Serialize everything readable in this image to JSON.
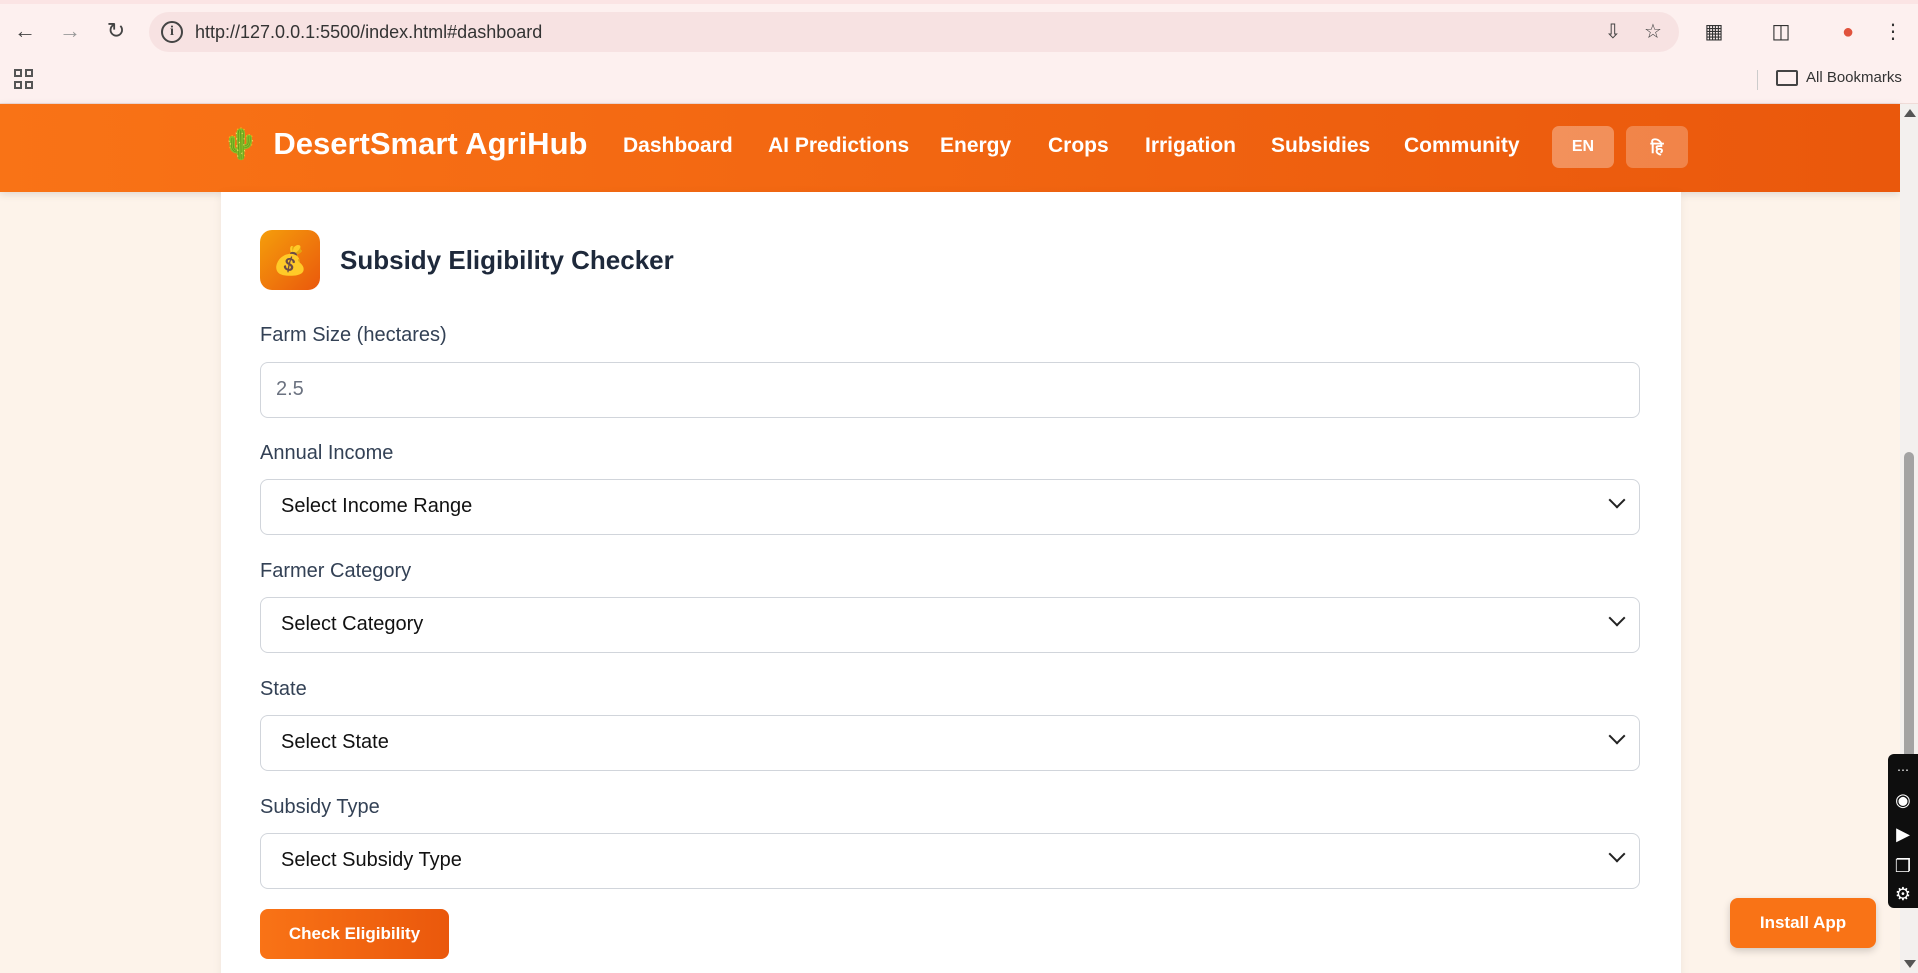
{
  "browser": {
    "url": "http://127.0.0.1:5500/index.html#dashboard",
    "bookmarks_label": "All Bookmarks"
  },
  "app": {
    "brand_icon": "🌵",
    "brand_name": "DesertSmart AgriHub",
    "nav": [
      "Dashboard",
      "AI Predictions",
      "Energy",
      "Crops",
      "Irrigation",
      "Subsidies",
      "Community"
    ],
    "lang": {
      "en": "EN",
      "hi": "हि"
    }
  },
  "card": {
    "icon": "💰",
    "title": "Subsidy Eligibility Checker",
    "fields": [
      {
        "label": "Farm Size (hectares)",
        "type": "input",
        "placeholder": "2.5"
      },
      {
        "label": "Annual Income",
        "type": "select",
        "value": "Select Income Range"
      },
      {
        "label": "Farmer Category",
        "type": "select",
        "value": "Select Category"
      },
      {
        "label": "State",
        "type": "select",
        "value": "Select State"
      },
      {
        "label": "Subsidy Type",
        "type": "select",
        "value": "Select Subsidy Type"
      }
    ],
    "button": "Check Eligibility"
  },
  "install_button": "Install App",
  "colors": {
    "primary": "#f97316",
    "primary_dark": "#ea580c"
  }
}
